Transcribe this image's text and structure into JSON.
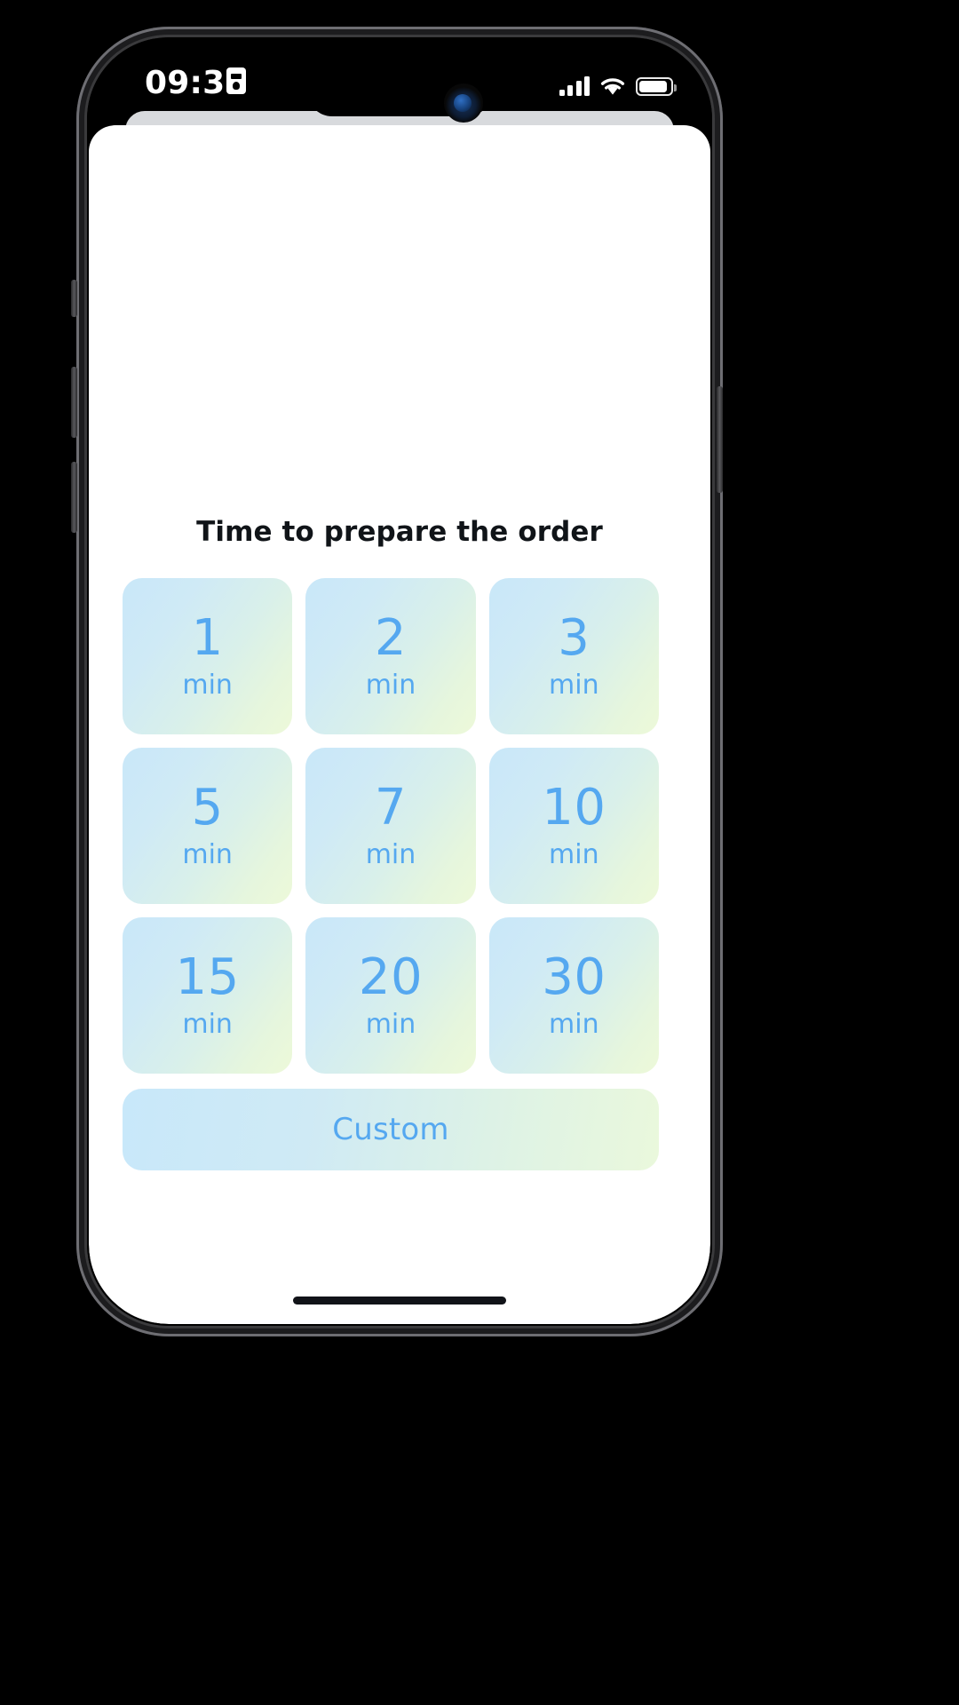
{
  "status_bar": {
    "time": "09:34",
    "recording_icon": "id-card-icon",
    "signal_icon": "cellular-signal-icon",
    "wifi_icon": "wifi-icon",
    "battery_icon": "battery-icon",
    "signal_bars": 4,
    "battery_level_percent": 85
  },
  "app": {
    "title": "Time to prepare the order",
    "accent_color": "#55a8f0",
    "card_gradient_start": "#c9e7f9",
    "card_gradient_end": "#edf9d9",
    "time_options": [
      {
        "value": "1",
        "unit": "min"
      },
      {
        "value": "2",
        "unit": "min"
      },
      {
        "value": "3",
        "unit": "min"
      },
      {
        "value": "5",
        "unit": "min"
      },
      {
        "value": "7",
        "unit": "min"
      },
      {
        "value": "10",
        "unit": "min"
      },
      {
        "value": "15",
        "unit": "min"
      },
      {
        "value": "20",
        "unit": "min"
      },
      {
        "value": "30",
        "unit": "min"
      }
    ],
    "custom_button_label": "Custom"
  }
}
